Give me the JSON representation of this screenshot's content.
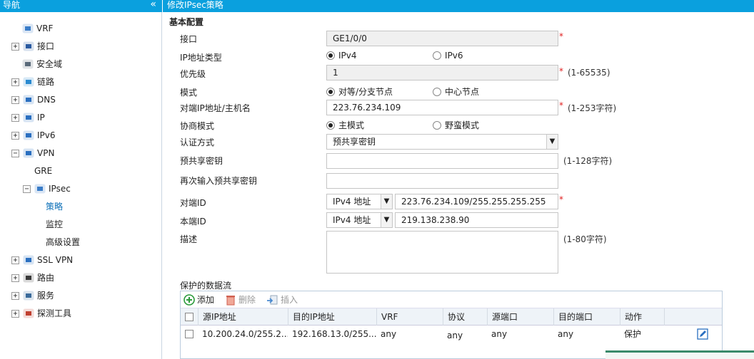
{
  "nav": {
    "title": "导航",
    "collapse": "«",
    "items": [
      {
        "label": "VRF",
        "icon": "vrf-icon",
        "expand": ""
      },
      {
        "label": "接口",
        "icon": "interface-icon",
        "expand": "+"
      },
      {
        "label": "安全域",
        "icon": "security-zone-icon",
        "expand": ""
      },
      {
        "label": "链路",
        "icon": "link-icon",
        "expand": "+"
      },
      {
        "label": "DNS",
        "icon": "dns-icon",
        "expand": "+"
      },
      {
        "label": "IP",
        "icon": "ip-icon",
        "expand": "+"
      },
      {
        "label": "IPv6",
        "icon": "ipv6-icon",
        "expand": "+"
      },
      {
        "label": "VPN",
        "icon": "vpn-icon",
        "expand": "−"
      },
      {
        "label": "GRE",
        "icon": "",
        "expand": ""
      },
      {
        "label": "IPsec",
        "icon": "ipsec-icon",
        "expand": "−"
      },
      {
        "label": "策略",
        "icon": "",
        "expand": ""
      },
      {
        "label": "监控",
        "icon": "",
        "expand": ""
      },
      {
        "label": "高级设置",
        "icon": "",
        "expand": ""
      },
      {
        "label": "SSL VPN",
        "icon": "sslvpn-icon",
        "expand": "+"
      },
      {
        "label": "路由",
        "icon": "route-icon",
        "expand": "+"
      },
      {
        "label": "服务",
        "icon": "service-icon",
        "expand": "+"
      },
      {
        "label": "探测工具",
        "icon": "probe-tool-icon",
        "expand": "+"
      }
    ]
  },
  "main": {
    "title": "修改IPsec策略",
    "section": "基本配置"
  },
  "form": {
    "interface": {
      "label": "接口",
      "value": "GE1/0/0",
      "star": "*"
    },
    "ip_type": {
      "label": "IP地址类型",
      "opt1": "IPv4",
      "opt2": "IPv6"
    },
    "priority": {
      "label": "优先级",
      "value": "1",
      "star": "*",
      "hint": "(1-65535)"
    },
    "mode": {
      "label": "模式",
      "opt1": "对等/分支节点",
      "opt2": "中心节点"
    },
    "peer": {
      "label": "对端IP地址/主机名",
      "value": "223.76.234.109",
      "star": "*",
      "hint": "(1-253字符)"
    },
    "nego": {
      "label": "协商模式",
      "opt1": "主模式",
      "opt2": "野蛮模式"
    },
    "auth": {
      "label": "认证方式",
      "value": "预共享密钥"
    },
    "psk": {
      "label": "预共享密钥",
      "value": "",
      "hint": "(1-128字符)"
    },
    "psk2": {
      "label": "再次输入预共享密钥",
      "value": ""
    },
    "peer_id": {
      "label": "对端ID",
      "type": "IPv4 地址",
      "value": "223.76.234.109/255.255.255.255",
      "star": "*"
    },
    "local_id": {
      "label": "本端ID",
      "type": "IPv4 地址",
      "value": "219.138.238.90"
    },
    "desc": {
      "label": "描述",
      "value": "",
      "hint": "(1-80字符)"
    },
    "flows_label": "保护的数据流"
  },
  "toolbar": {
    "add": "添加",
    "delete": "删除",
    "insert": "插入"
  },
  "table": {
    "headers": [
      "源IP地址",
      "目的IP地址",
      "VRF",
      "协议",
      "源端口",
      "目的端口",
      "动作"
    ],
    "rows": [
      [
        "10.200.24.0/255.2...",
        "192.168.13.0/255....",
        "any",
        "any",
        "any",
        "any",
        "保护"
      ]
    ]
  },
  "colors": {
    "header": "#0aa0de",
    "required": "#e02020",
    "selected": "#0b6fb8"
  }
}
